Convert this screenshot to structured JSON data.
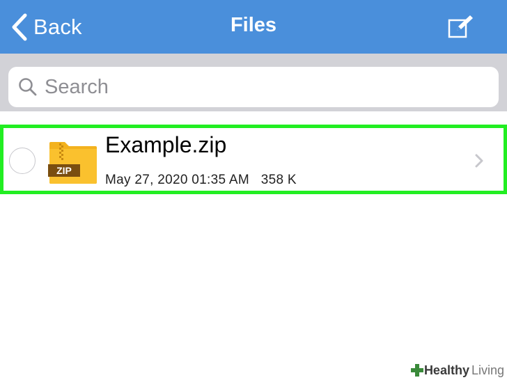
{
  "navbar": {
    "back_label": "Back",
    "title": "Files",
    "color": "#4a8fdb"
  },
  "search": {
    "placeholder": "Search"
  },
  "files": [
    {
      "name": "Example.zip",
      "icon_badge": "ZIP",
      "date": "May 27, 2020 01:35 AM",
      "size": "358 K",
      "highlight_color": "#22ee22"
    }
  ],
  "watermark": {
    "brand_bold": "Healthy",
    "brand_light": "Living"
  }
}
